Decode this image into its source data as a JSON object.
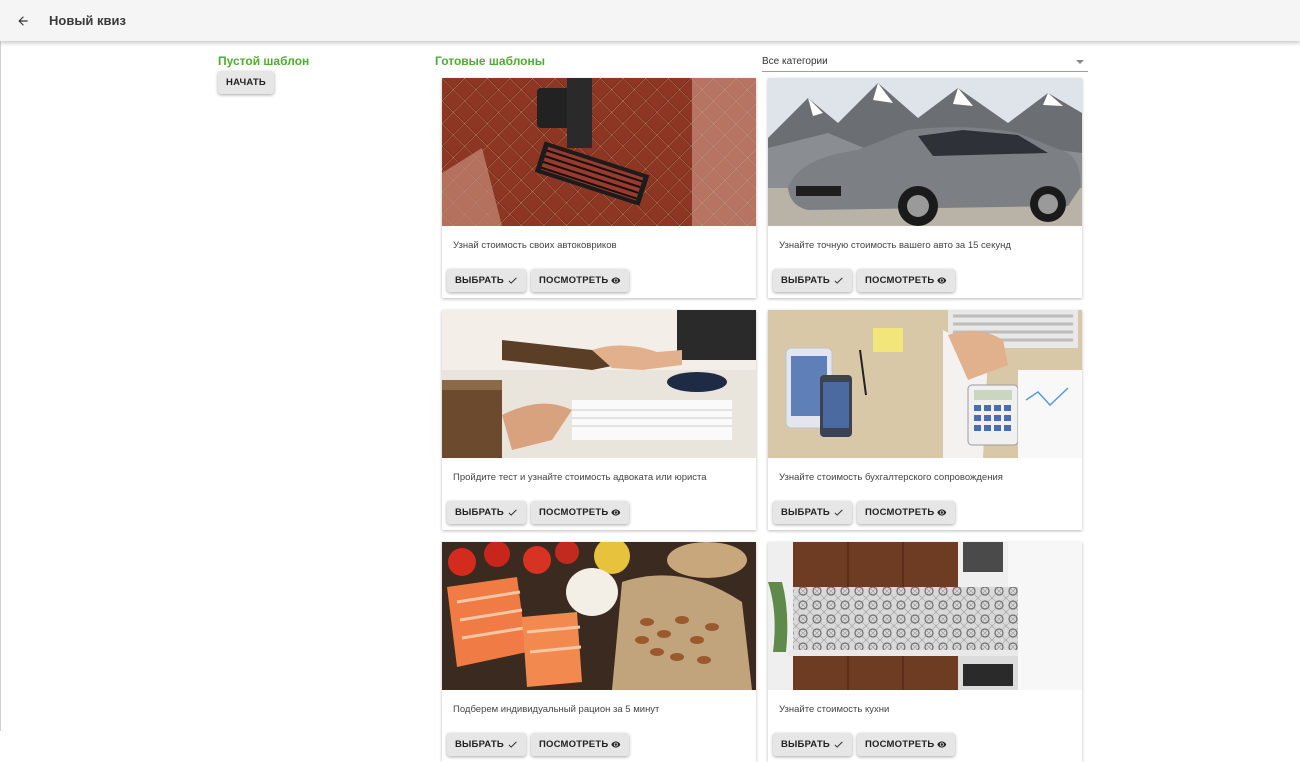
{
  "appbar": {
    "title": "Новый квиз",
    "back_icon": "arrow-left-icon"
  },
  "empty_template": {
    "title": "Пустой шаблон",
    "start_label": "НАЧАТЬ"
  },
  "ready_templates": {
    "title": "Готовые шаблоны"
  },
  "category_select": {
    "value": "Все категории"
  },
  "cards": [
    {
      "text": "Узнай стоимость своих автоковриков",
      "select_label": "ВЫБРАТЬ",
      "view_label": "ПОСМОТРЕТЬ",
      "image": "car-floor-mat-photo"
    },
    {
      "text": "Узнайте точную стоимость вашего авто за 15 секунд",
      "select_label": "ВЫБРАТЬ",
      "view_label": "ПОСМОТРЕТЬ",
      "image": "silver-suv-mountains-photo"
    },
    {
      "text": "Пройдите тест и узнайте стоимость адвоката или юриста",
      "select_label": "ВЫБРАТЬ",
      "view_label": "ПОСМОТРЕТЬ",
      "image": "handshake-office-photo"
    },
    {
      "text": "Узнайте стоимость бухгалтерского сопровождения",
      "select_label": "ВЫБРАТЬ",
      "view_label": "ПОСМОТРЕТЬ",
      "image": "accounting-desk-photo"
    },
    {
      "text": "Подберем индивидуальный рацион за 5 минут",
      "select_label": "ВЫБРАТЬ",
      "view_label": "ПОСМОТРЕТЬ",
      "image": "salmon-food-photo"
    },
    {
      "text": "Узнайте стоимость кухни",
      "select_label": "ВЫБРАТЬ",
      "view_label": "ПОСМОТРЕТЬ",
      "image": "kitchen-interior-photo"
    }
  ],
  "colors": {
    "accent_green": "#4cae2b",
    "appbar_bg": "#f5f5f5",
    "button_bg": "#e6e6e6"
  }
}
